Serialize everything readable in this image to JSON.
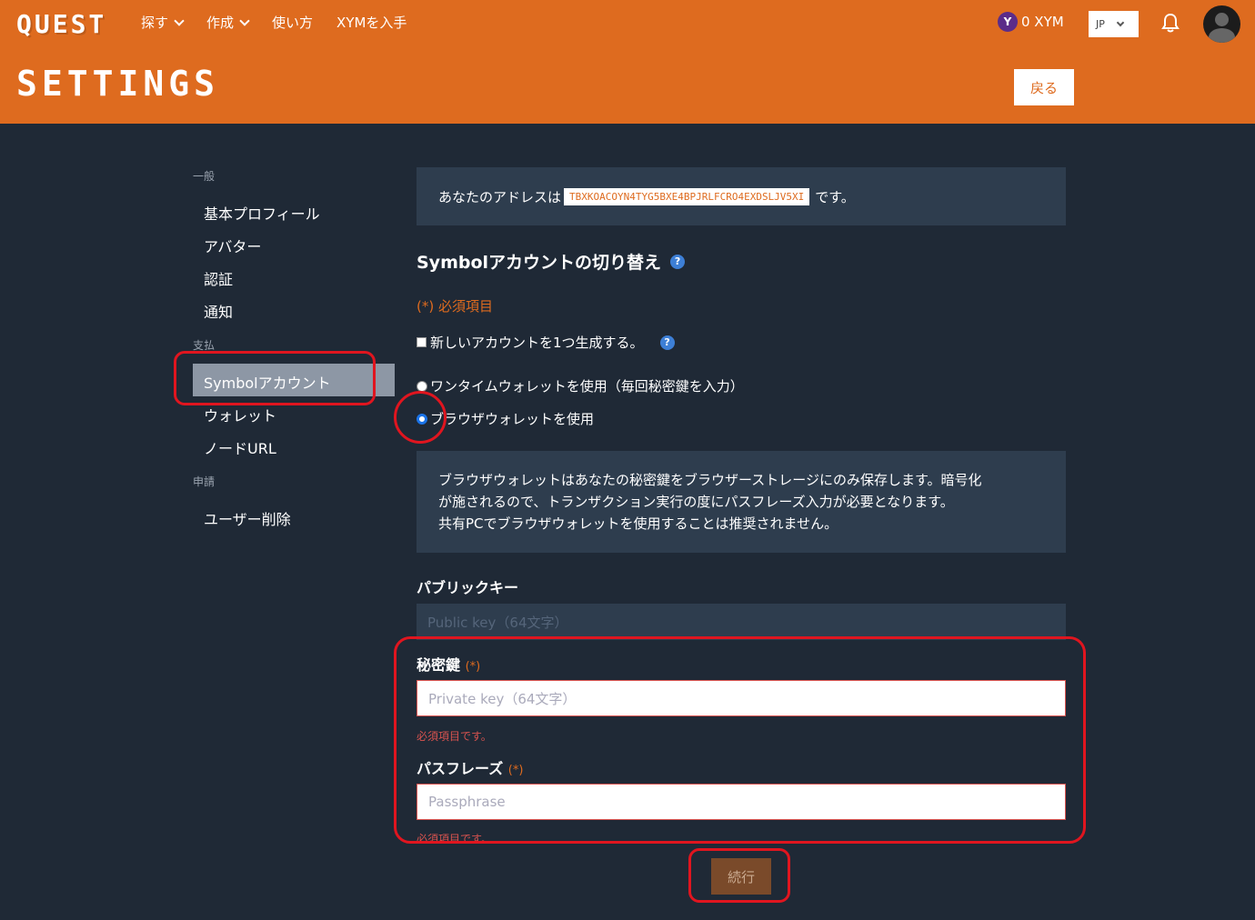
{
  "header": {
    "logo": "QUEST",
    "nav": [
      {
        "label": "探す",
        "dropdown": true
      },
      {
        "label": "作成",
        "dropdown": true
      },
      {
        "label": "使い方",
        "dropdown": false
      },
      {
        "label": "XYMを入手",
        "dropdown": false
      }
    ],
    "xym_balance": "0 XYM",
    "language": "JP",
    "page_title": "SETTINGS",
    "back_label": "戻る"
  },
  "sidebar": {
    "general_label": "一般",
    "general_items": [
      "基本プロフィール",
      "アバター",
      "認証",
      "通知"
    ],
    "payment_label": "支払",
    "payment_items": [
      "Symbolアカウント",
      "ウォレット",
      "ノードURL"
    ],
    "application_label": "申請",
    "application_items": [
      "ユーザー削除"
    ]
  },
  "main": {
    "address_prefix": "あなたのアドレスは",
    "address": "TBXKOACOYN4TYG5BXE4BPJRLFCRO4EXDSLJV5XI",
    "address_suffix": "です。",
    "section_title": "Symbolアカウントの切り替え",
    "required_note": "(*) 必須項目",
    "new_account_checkbox": "新しいアカウントを1つ生成する。",
    "radio_onetime": "ワンタイムウォレットを使用（毎回秘密鍵を入力）",
    "radio_browser": "ブラウザウォレットを使用",
    "info_line1": "ブラウザウォレットはあなたの秘密鍵をブラウザーストレージにのみ保存します。暗号化",
    "info_line2": "が施されるので、トランザクション実行の度にパスフレーズ入力が必要となります。",
    "info_line3": "共有PCでブラウザウォレットを使用することは推奨されません。",
    "public_key_label": "パブリックキー",
    "public_key_placeholder": "Public key（64文字）",
    "private_key_label": "秘密鍵",
    "required_mark": "(*)",
    "private_key_placeholder": "Private key（64文字）",
    "required_error": "必須項目です。",
    "passphrase_label": "パスフレーズ",
    "passphrase_placeholder": "Passphrase",
    "submit_label": "続行"
  }
}
